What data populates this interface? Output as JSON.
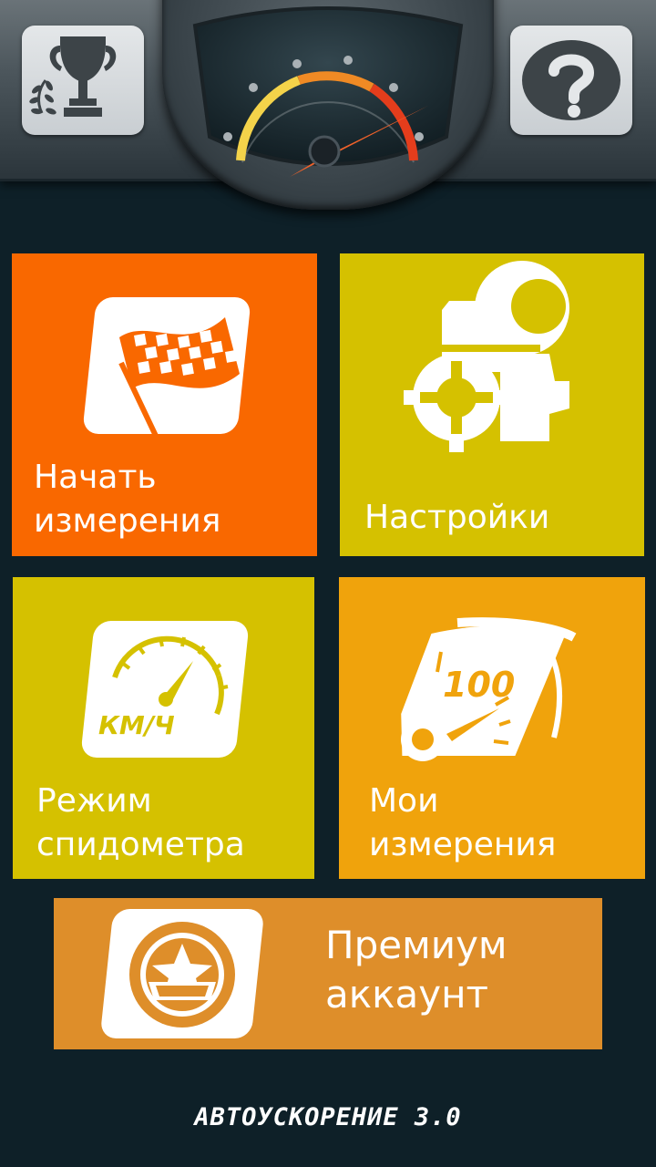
{
  "header": {
    "trophy_icon": "trophy-icon",
    "help_icon": "help-icon",
    "gauge_icon": "gauge-icon"
  },
  "tiles": {
    "start": {
      "line1": "Начать",
      "line2": "измерения",
      "color": "#f96800",
      "icon": "checkered-flag-icon"
    },
    "settings": {
      "line1": "Настройки",
      "color": "#d5c100",
      "icon": "gears-icon"
    },
    "speedometer": {
      "line1": "Режим",
      "line2": "спидометра",
      "color": "#d5c100",
      "icon": "speedometer-kmh-icon",
      "unit": "КМ/Ч"
    },
    "measurements": {
      "line1": "Мои",
      "line2": "измерения",
      "color": "#f0a30c",
      "icon": "speed-100-icon",
      "number": "100"
    },
    "premium": {
      "line1": "Премиум",
      "line2": "аккаунт",
      "color": "#de8e2a",
      "icon": "star-badge-icon"
    }
  },
  "footer": {
    "title": "АВТОУСКОРЕНИЕ 3.0"
  },
  "colors": {
    "background": "#0e2028",
    "accent_orange": "#f96800"
  }
}
